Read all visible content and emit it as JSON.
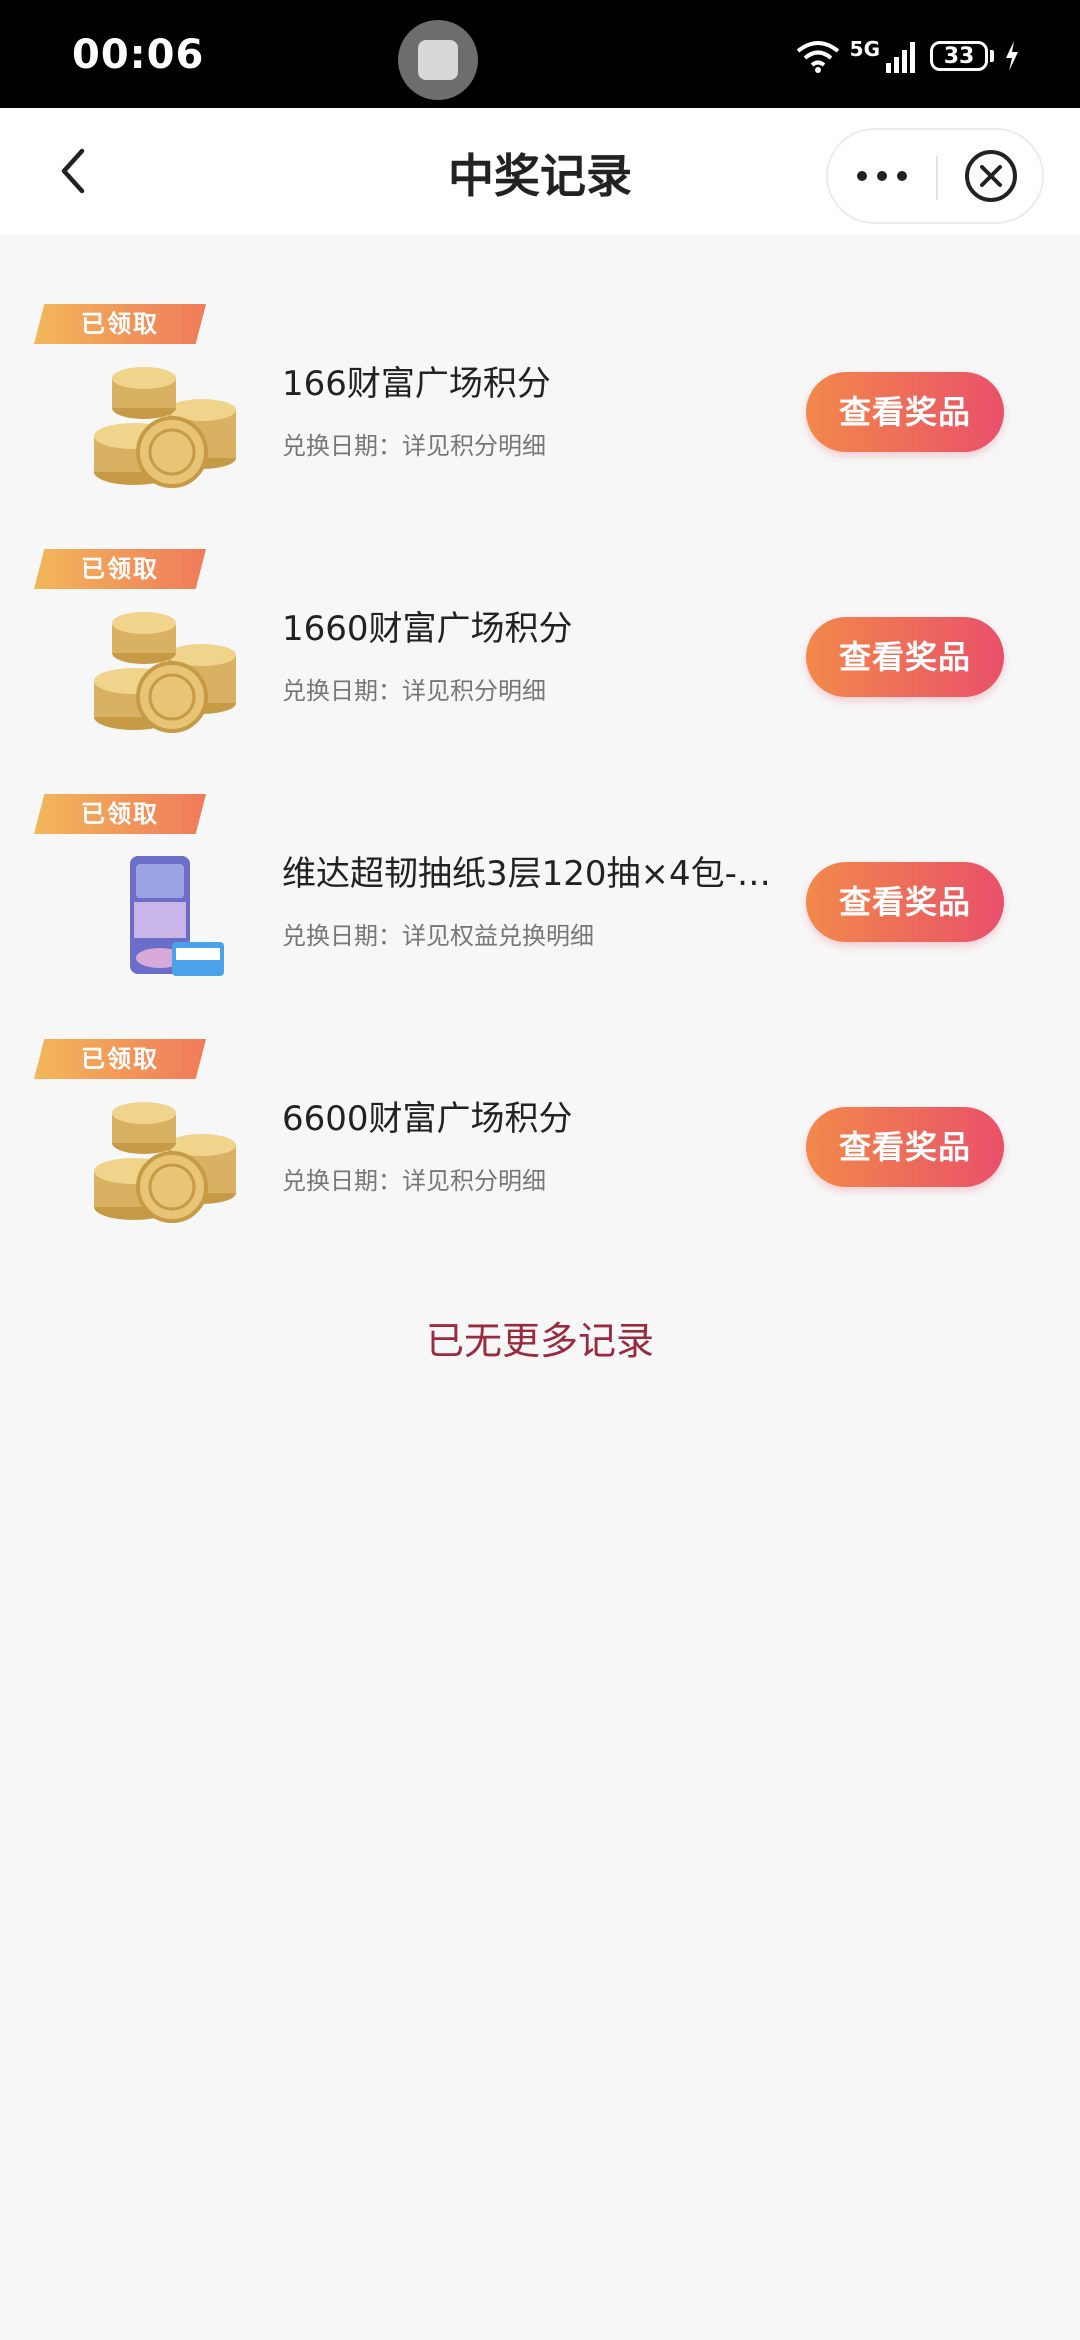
{
  "status_bar": {
    "time": "00:06",
    "network": "5G",
    "battery": "33"
  },
  "header": {
    "title": "中奖记录"
  },
  "records": [
    {
      "tag": "已领取",
      "title": "166财富广场积分",
      "subtitle": "兑换日期：详见积分明细",
      "button": "查看奖品",
      "image": "gold-coins"
    },
    {
      "tag": "已领取",
      "title": "1660财富广场积分",
      "subtitle": "兑换日期：详见积分明细",
      "button": "查看奖品",
      "image": "gold-coins"
    },
    {
      "tag": "已领取",
      "title": "维达超韧抽纸3层120抽×4包-券...",
      "subtitle": "兑换日期：详见权益兑换明细",
      "button": "查看奖品",
      "image": "tissue-pack"
    },
    {
      "tag": "已领取",
      "title": "6600财富广场积分",
      "subtitle": "兑换日期：详见积分明细",
      "button": "查看奖品",
      "image": "gold-coins"
    }
  ],
  "footer": {
    "no_more": "已无更多记录"
  },
  "colors": {
    "accent_start": "#f2894a",
    "accent_end": "#e9506a",
    "tag_start": "#f2b85a",
    "tag_end": "#f07a5a",
    "no_more_text": "#9a2a3e"
  }
}
